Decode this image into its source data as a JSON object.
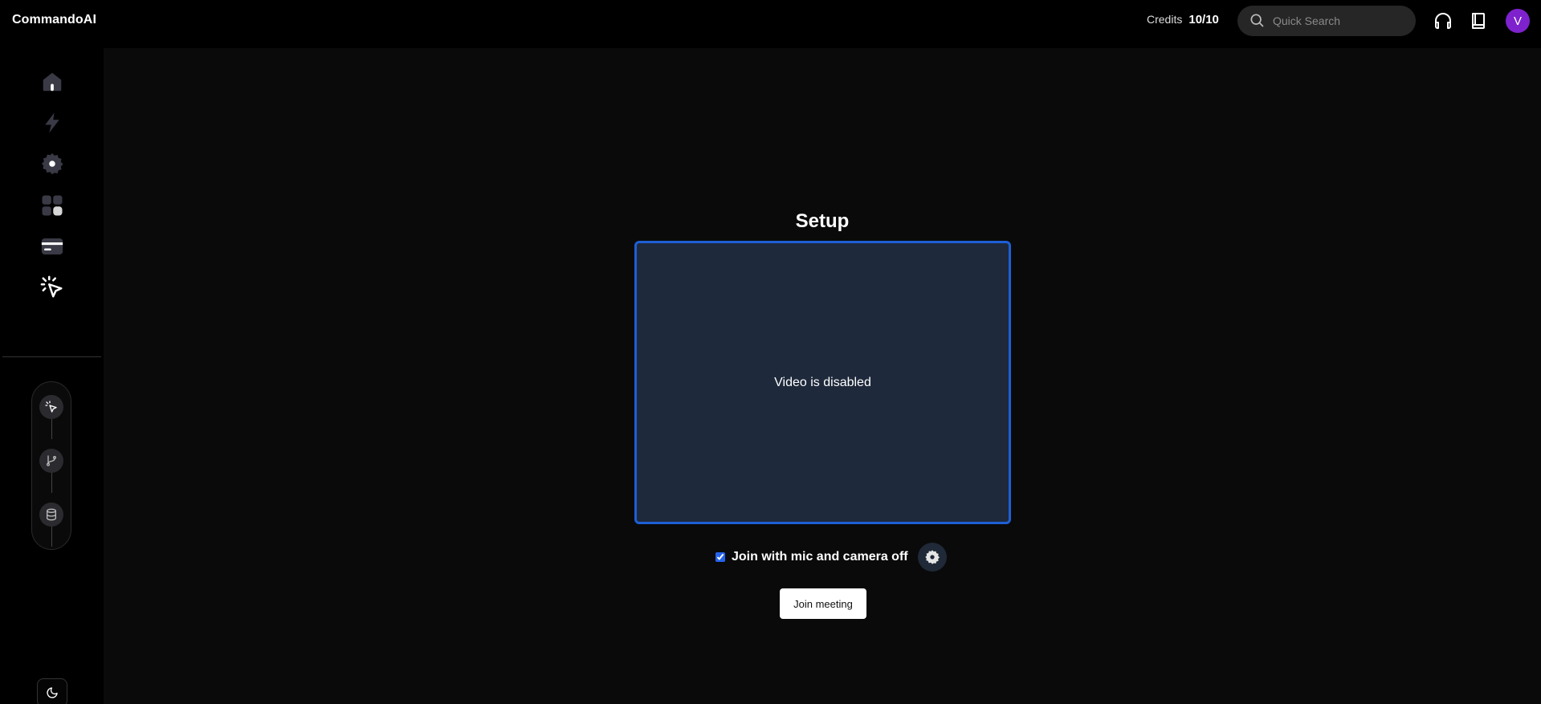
{
  "app": {
    "name": "CommandoAI"
  },
  "header": {
    "credits_label": "Credits",
    "credits_value": "10/10",
    "search_placeholder": "Quick Search",
    "avatar_initial": "V"
  },
  "sidebar": {
    "items": [
      {
        "icon": "home-icon",
        "active": false
      },
      {
        "icon": "lightning-icon",
        "active": false
      },
      {
        "icon": "gear-icon",
        "active": false
      },
      {
        "icon": "apps-grid-icon",
        "active": false
      },
      {
        "icon": "credit-card-icon",
        "active": true
      },
      {
        "icon": "cursor-click-icon",
        "active": true
      }
    ],
    "tools": [
      {
        "icon": "cursor-sparkle-icon"
      },
      {
        "icon": "branch-icon"
      },
      {
        "icon": "database-icon"
      }
    ],
    "theme_icon": "moon-icon"
  },
  "main": {
    "title": "Setup",
    "video_status": "Video is disabled",
    "join_checkbox_label": "Join with mic and camera off",
    "join_checkbox_checked": true,
    "join_button_label": "Join meeting"
  },
  "colors": {
    "accent_border": "#1d5fd6",
    "avatar_bg": "#7e22ce",
    "video_bg": "#1e293b"
  }
}
